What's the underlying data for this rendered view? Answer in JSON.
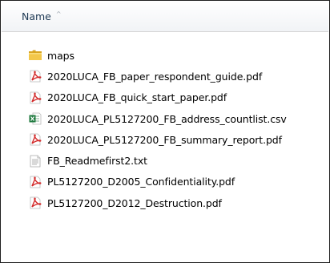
{
  "header": {
    "name_label": "Name",
    "sort_indicator": "^"
  },
  "files": [
    {
      "name": "maps",
      "icon": "folder-icon"
    },
    {
      "name": "2020LUCA_FB_paper_respondent_guide.pdf",
      "icon": "pdf-file-icon"
    },
    {
      "name": "2020LUCA_FB_quick_start_paper.pdf",
      "icon": "pdf-file-icon"
    },
    {
      "name": "2020LUCA_PL5127200_FB_address_countlist.csv",
      "icon": "excel-csv-file-icon"
    },
    {
      "name": "2020LUCA_PL5127200_FB_summary_report.pdf",
      "icon": "pdf-file-icon"
    },
    {
      "name": "FB_Readmefirst2.txt",
      "icon": "text-file-icon"
    },
    {
      "name": "PL5127200_D2005_Confidentiality.pdf",
      "icon": "pdf-file-icon"
    },
    {
      "name": "PL5127200_D2012_Destruction.pdf",
      "icon": "pdf-file-icon"
    }
  ],
  "colors": {
    "pdf_red": "#d32b2b",
    "excel_green": "#1f7a3f",
    "folder_yellow": "#e8b83a"
  }
}
